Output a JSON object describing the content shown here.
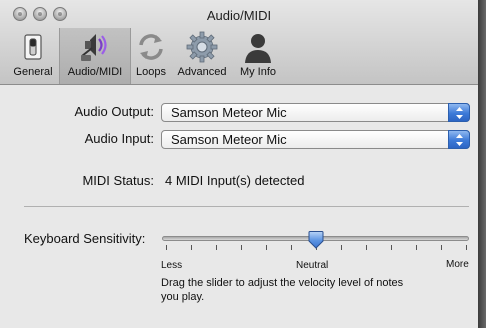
{
  "window": {
    "title": "Audio/MIDI"
  },
  "toolbar": {
    "items": [
      {
        "label": "General",
        "icon": "switch-icon",
        "selected": false
      },
      {
        "label": "Audio/MIDI",
        "icon": "speaker-icon",
        "selected": true
      },
      {
        "label": "Loops",
        "icon": "loops-icon",
        "selected": false
      },
      {
        "label": "Advanced",
        "icon": "gear-icon",
        "selected": false
      },
      {
        "label": "My Info",
        "icon": "person-icon",
        "selected": false
      }
    ]
  },
  "audio": {
    "output_label": "Audio Output:",
    "output_value": "Samson Meteor Mic",
    "input_label": "Audio Input:",
    "input_value": "Samson Meteor Mic"
  },
  "midi": {
    "status_label": "MIDI Status:",
    "status_value": "4 MIDI Input(s) detected"
  },
  "keyboard": {
    "label": "Keyboard Sensitivity:",
    "min_label": "Less",
    "mid_label": "Neutral",
    "max_label": "More",
    "value_fraction": 0.5,
    "help": "Drag the slider to adjust the velocity level of notes you play."
  },
  "colors": {
    "accent": "#3d7ad8",
    "window_bg": "#e8e8e8"
  }
}
